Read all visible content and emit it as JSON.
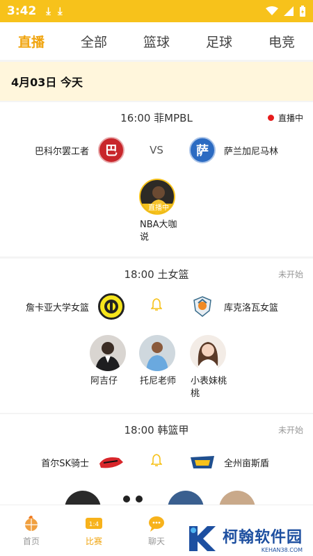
{
  "status_bar": {
    "time": "3:42",
    "download_icons": [
      "download-icon",
      "download-icon"
    ]
  },
  "tabs": [
    {
      "label": "直播",
      "active": true
    },
    {
      "label": "全部",
      "active": false
    },
    {
      "label": "篮球",
      "active": false
    },
    {
      "label": "足球",
      "active": false
    },
    {
      "label": "电竞",
      "active": false
    }
  ],
  "date_header": "4月03日 今天",
  "matches": [
    {
      "time_league": "16:00 菲MPBL",
      "status": "直播中",
      "home": {
        "name": "巴科尔罢工者",
        "logo_char": "巴",
        "logo_color": "#c8262b"
      },
      "vs": "VS",
      "away": {
        "name": "萨兰加尼马林",
        "logo_char": "萨",
        "logo_color": "#2c6bc2"
      },
      "hosts": [
        {
          "name": "NBA大咖说",
          "live_tag": "直播中"
        }
      ]
    },
    {
      "time_league": "18:00 土女篮",
      "status": "未开始",
      "home": {
        "name": "詹卡亚大学女篮"
      },
      "away": {
        "name": "库克洛瓦女篮"
      },
      "hosts": [
        {
          "name": "阿吉仔"
        },
        {
          "name": "托尼老师"
        },
        {
          "name": "小表妹桃桃"
        }
      ]
    },
    {
      "time_league": "18:00 韩篮甲",
      "status": "未开始",
      "home": {
        "name": "首尔SK骑士"
      },
      "away": {
        "name": "全州亩斯盾"
      }
    }
  ],
  "bottom_nav": [
    {
      "label": "首页",
      "active": false
    },
    {
      "label": "比赛",
      "active": true
    },
    {
      "label": "聊天",
      "active": false
    }
  ],
  "watermark": {
    "cn": "柯翰软件园",
    "en": "KEHAN38.COM"
  },
  "colors": {
    "accent": "#f7c21b",
    "tab_active": "#f0a40e",
    "live_dot": "#e61c1c",
    "date_band": "#fff6dc"
  }
}
